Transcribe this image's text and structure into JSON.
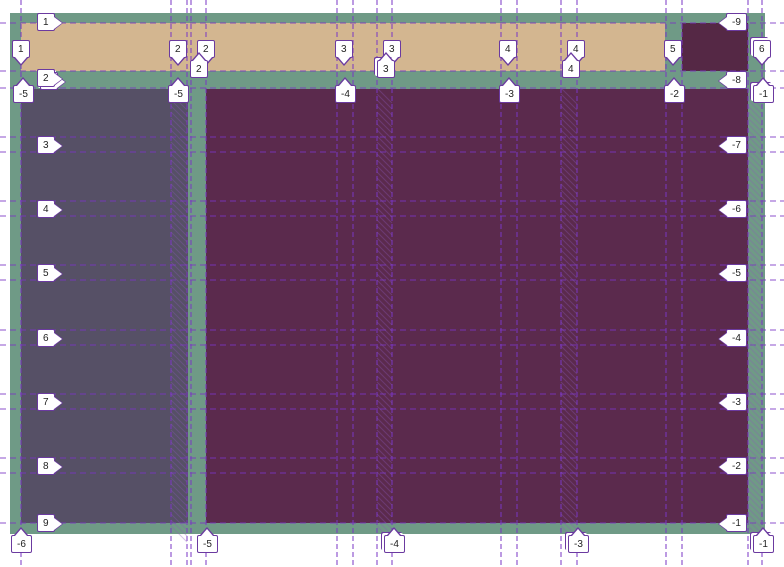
{
  "colors": {
    "container": "#6f9a86",
    "header": "#d3b690",
    "corner": "#552845",
    "sidebar": "#565066",
    "main": "#5b2a4d",
    "gridline": "#7a35c4"
  },
  "areas": [
    {
      "key": "header"
    },
    {
      "key": "corner"
    },
    {
      "key": "sidebar"
    },
    {
      "key": "main"
    }
  ],
  "labels": {
    "top_row": [
      "1",
      "2",
      "2",
      "3",
      "3",
      "4",
      "4",
      "5",
      "6"
    ],
    "top_left_col": "1",
    "top_right_neg": "-9",
    "row_top_left": [
      "2",
      "2"
    ],
    "row_upper_line": [
      "-5",
      "-5",
      "-4",
      "-3",
      "-2",
      "-1"
    ],
    "row_upper_mid": [
      "2",
      "3",
      "4"
    ],
    "row_upper_right": [
      "-8"
    ],
    "left_rows": [
      "3",
      "4",
      "5",
      "6",
      "7",
      "8",
      "9"
    ],
    "right_rows": [
      "-7",
      "-6",
      "-5",
      "-4",
      "-3",
      "-2",
      "-1"
    ],
    "bottom_row": [
      "-6",
      "-5",
      "-4",
      "-3",
      "-1"
    ]
  }
}
